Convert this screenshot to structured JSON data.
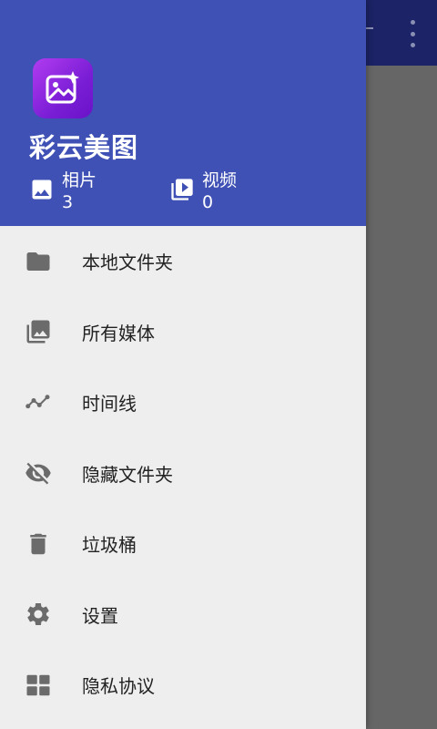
{
  "drawer": {
    "app_name": "彩云美图",
    "stats": [
      {
        "label": "相片",
        "count": "3",
        "icon": "image-icon"
      },
      {
        "label": "视频",
        "count": "0",
        "icon": "video-library-icon"
      }
    ],
    "menu": [
      {
        "label": "本地文件夹",
        "icon": "folder-icon"
      },
      {
        "label": "所有媒体",
        "icon": "photo-library-icon"
      },
      {
        "label": "时间线",
        "icon": "timeline-icon"
      },
      {
        "label": "隐藏文件夹",
        "icon": "hidden-eye-icon"
      },
      {
        "label": "垃圾桶",
        "icon": "trash-icon"
      },
      {
        "label": "设置",
        "icon": "settings-gear-icon"
      },
      {
        "label": "隐私协议",
        "icon": "grid-icon"
      }
    ]
  },
  "colors": {
    "header": "#3f51b5",
    "drawer_bg": "#eeeeee",
    "icon": "#6b6b6b",
    "logo_gradient_start": "#b23cf0",
    "logo_gradient_end": "#6a12c8"
  }
}
